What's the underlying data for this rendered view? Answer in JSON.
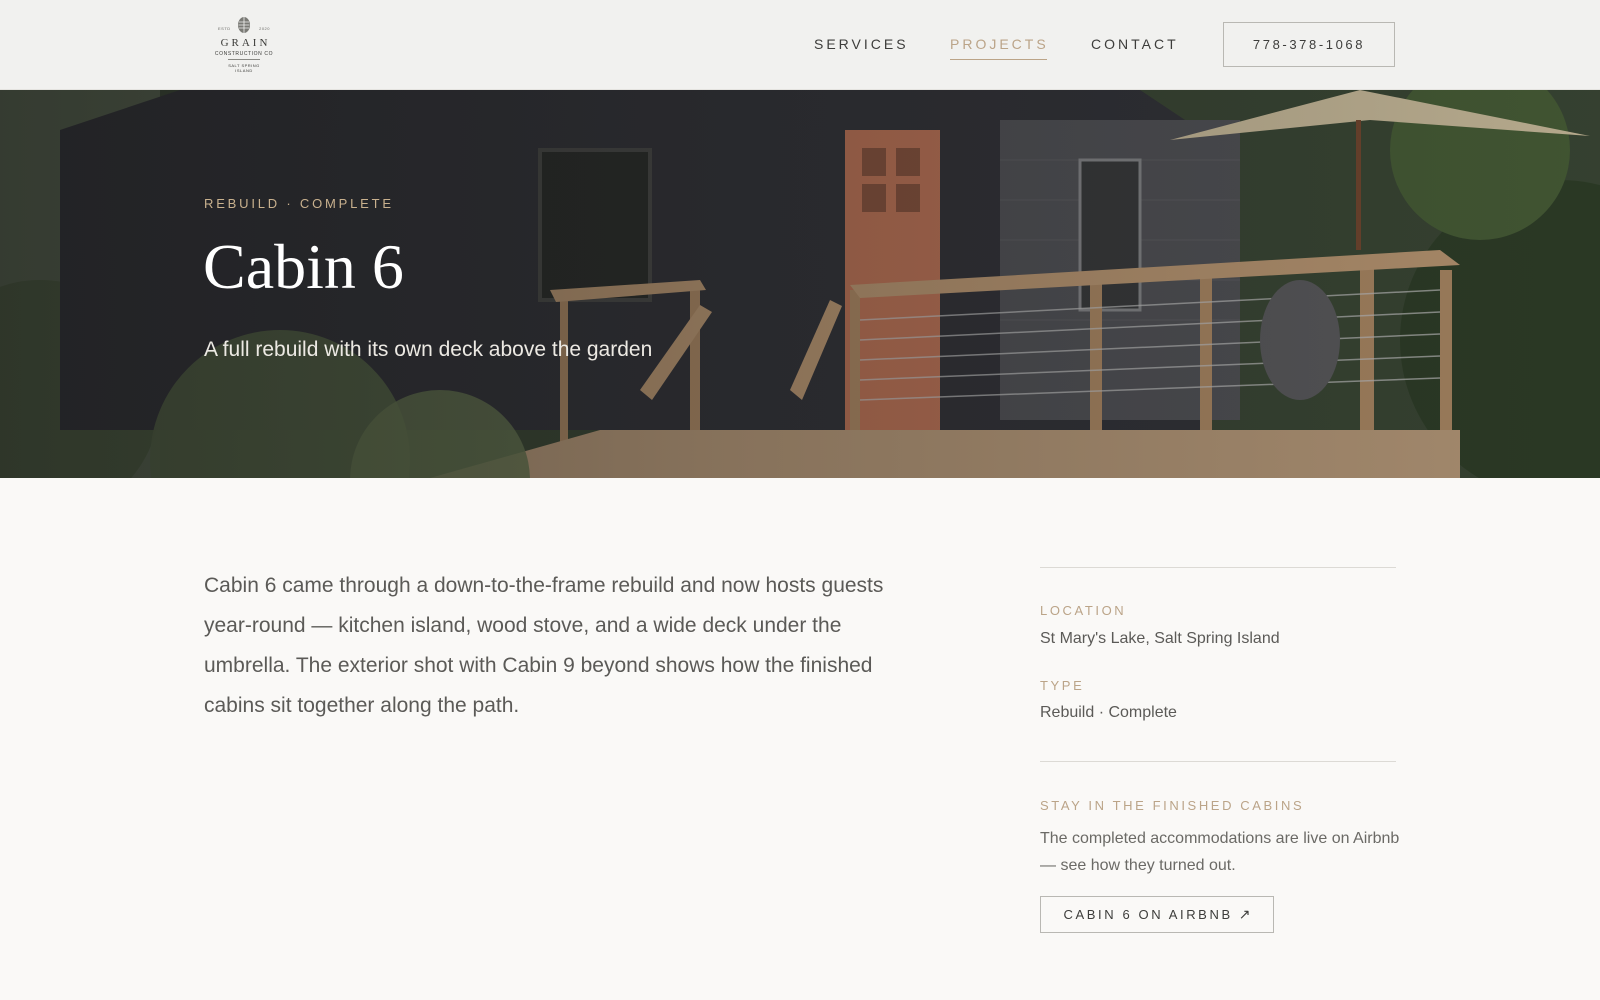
{
  "brand": {
    "name": "GRAIN",
    "subtitle": "CONSTRUCTION CO",
    "est_left": "ESTD",
    "est_right": "2020",
    "location_line1": "SALT SPRING",
    "location_line2": "ISLAND"
  },
  "nav": {
    "items": [
      {
        "label": "SERVICES",
        "active": false
      },
      {
        "label": "PROJECTS",
        "active": true
      },
      {
        "label": "CONTACT",
        "active": false
      }
    ],
    "phone": "778-378-1068"
  },
  "hero": {
    "eyebrow": "REBUILD · COMPLETE",
    "title": "Cabin 6",
    "subtitle": "A full rebuild with its own deck above the garden"
  },
  "main": {
    "description": "Cabin 6 came through a down-to-the-frame rebuild and now hosts guests year-round — kitchen island, wood stove, and a wide deck under the umbrella. The exterior shot with Cabin 9 beyond shows how the finished cabins sit together along the path."
  },
  "details": {
    "location_label": "LOCATION",
    "location_value": "St Mary's Lake, Salt Spring Island",
    "type_label": "TYPE",
    "type_value": "Rebuild · Complete",
    "stay_label": "STAY IN THE FINISHED CABINS",
    "stay_text": "The completed accommodations are live on Airbnb — see how they turned out.",
    "airbnb_label": "CABIN 6 ON AIRBNB",
    "airbnb_icon": "↗"
  },
  "colors": {
    "accent": "#bba488",
    "page_background": "#faf9f7",
    "header_background": "#f1f1ef",
    "body_text": "#5b5a57"
  },
  "icons": {
    "logo": "pinecone-logo-icon",
    "external_link": "arrow-up-right-icon"
  }
}
